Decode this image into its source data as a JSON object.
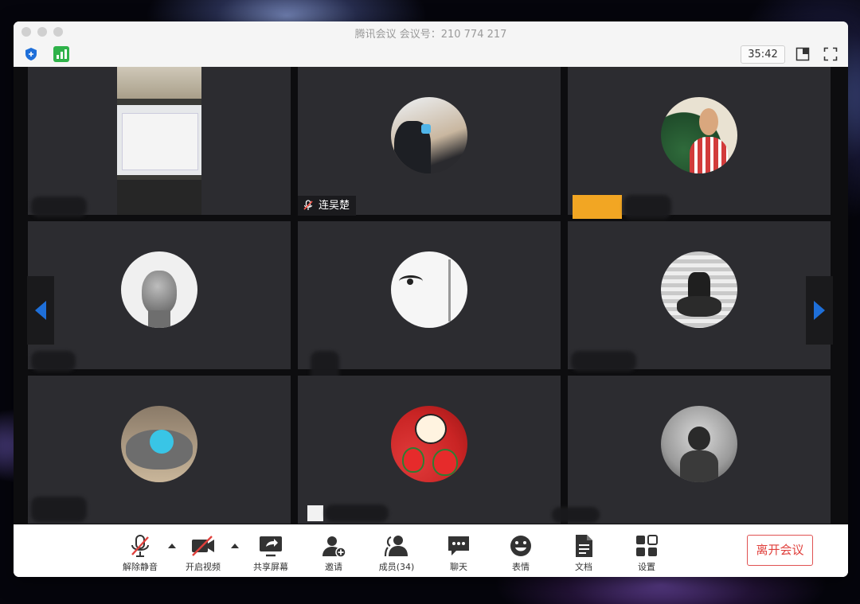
{
  "window": {
    "title": "腾讯会议 会议号：210 774 217",
    "timer": "35:42"
  },
  "participants": [
    {
      "name": "连吴楚",
      "muted": true
    }
  ],
  "toolbar": {
    "unmute": "解除静音",
    "start_video": "开启视频",
    "share_screen": "共享屏幕",
    "invite": "邀请",
    "members": "成员(34)",
    "chat": "聊天",
    "reactions": "表情",
    "documents": "文档",
    "settings": "设置",
    "leave": "离开会议"
  },
  "colors": {
    "accent_blue": "#1e6fd9",
    "signal_green": "#2fb24a",
    "leave_red": "#e0403c",
    "tile_bg": "#2c2c30"
  }
}
